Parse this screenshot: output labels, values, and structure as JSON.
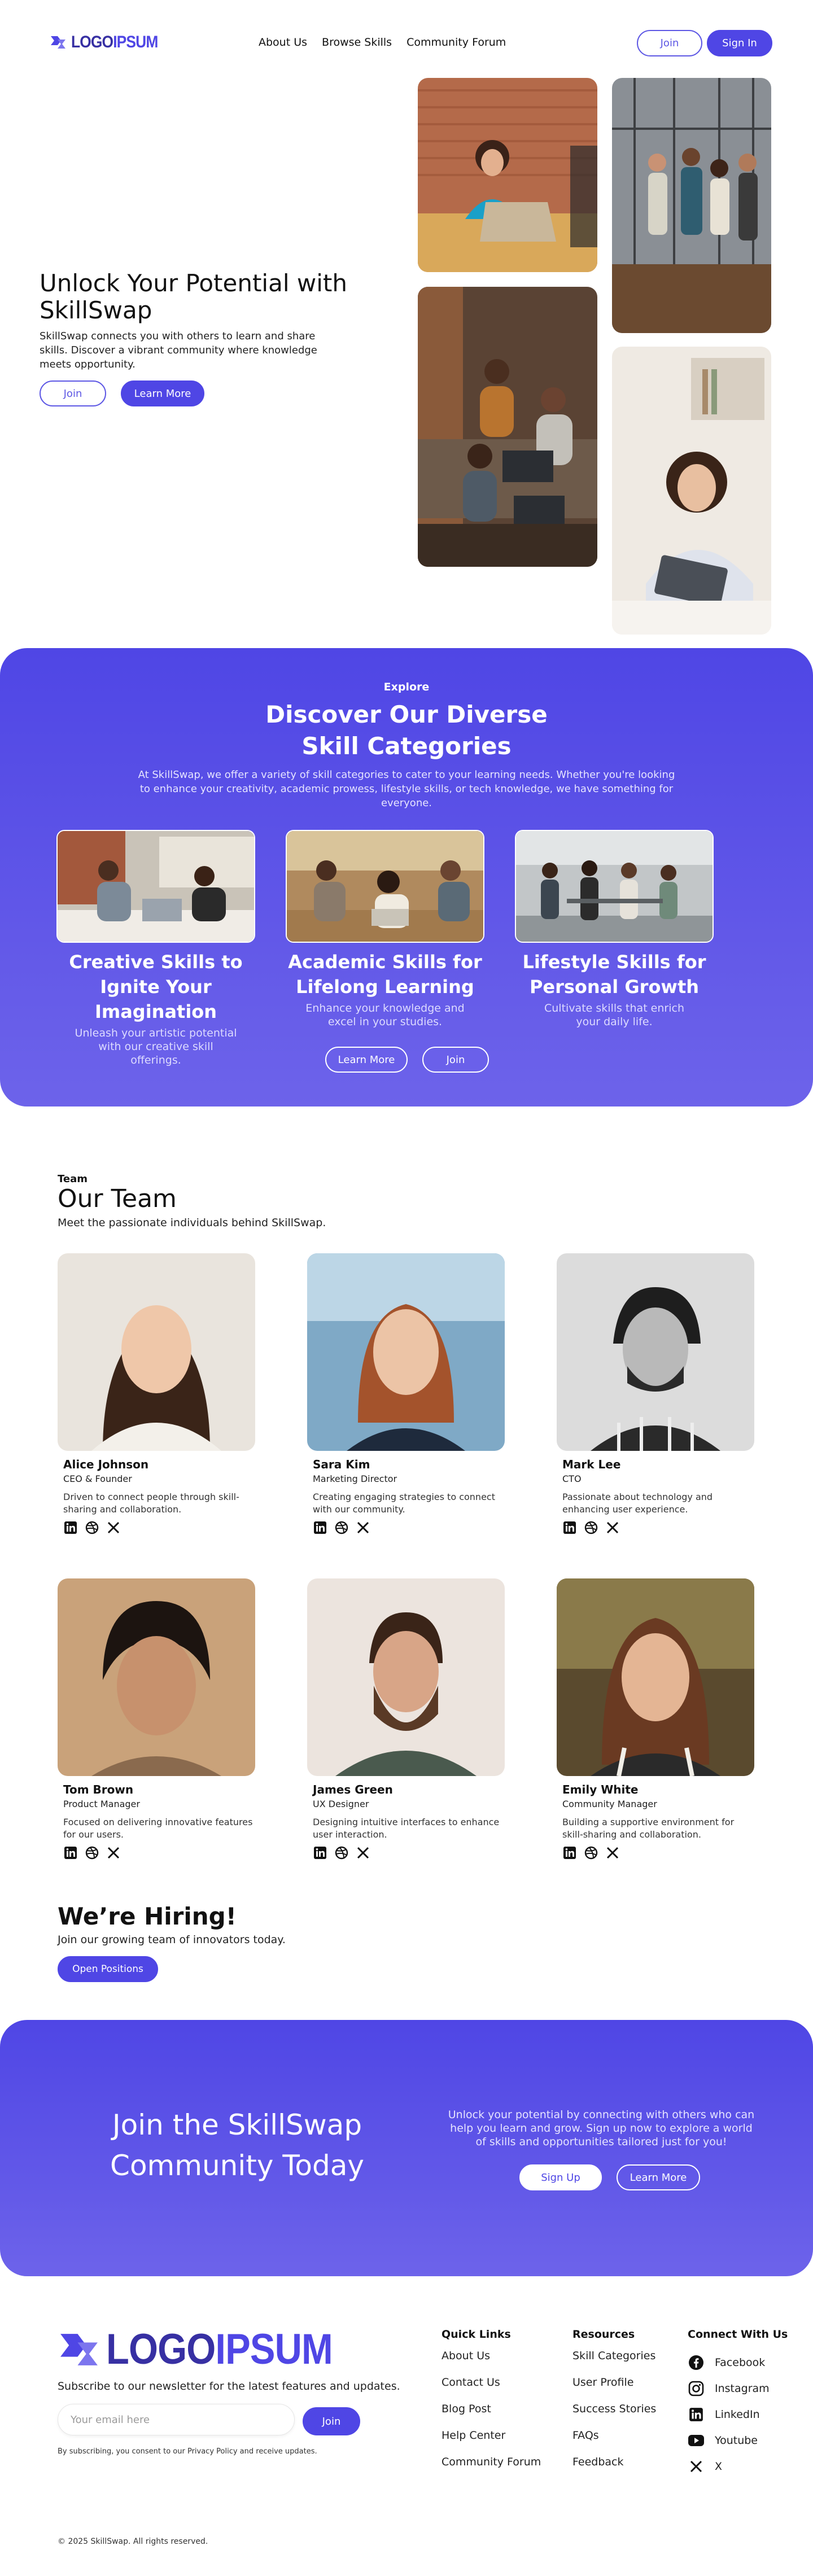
{
  "header": {
    "logo_text_a": "LOGO",
    "logo_text_b": "IPSUM",
    "nav": [
      "About Us",
      "Browse Skills",
      "Community Forum"
    ],
    "join_label": "Join",
    "signin_label": "Sign In"
  },
  "hero": {
    "title": "Unlock Your Potential with SkillSwap",
    "text": "SkillSwap connects you with others to learn and share skills. Discover a vibrant community where knowledge meets opportunity.",
    "join_label": "Join",
    "learn_label": "Learn More"
  },
  "explore": {
    "tag": "Explore",
    "title": "Discover Our Diverse Skill Categories",
    "text": "At SkillSwap, we offer a variety of skill categories to cater to your learning needs. Whether you're looking to enhance your creativity, academic prowess, lifestyle skills, or tech knowledge, we have something for everyone.",
    "categories": [
      {
        "title": "Creative Skills to Ignite Your Imagination",
        "desc": "Unleash your artistic potential with our creative skill offerings."
      },
      {
        "title": "Academic Skills for Lifelong Learning",
        "desc": "Enhance your knowledge and excel in your studies."
      },
      {
        "title": "Lifestyle Skills for Personal Growth",
        "desc": "Cultivate skills that enrich your daily life."
      }
    ],
    "learn_label": "Learn More",
    "join_label": "Join"
  },
  "team": {
    "tag": "Team",
    "title": "Our Team",
    "subtitle": "Meet the passionate individuals behind SkillSwap.",
    "members": [
      {
        "name": "Alice Johnson",
        "role": "CEO & Founder",
        "bio": "Driven to connect people through skill-sharing and collaboration."
      },
      {
        "name": "Sara Kim",
        "role": "Marketing Director",
        "bio": "Creating engaging strategies to connect with our community."
      },
      {
        "name": "Mark Lee",
        "role": "CTO",
        "bio": "Passionate about technology and enhancing user experience."
      },
      {
        "name": "Tom Brown",
        "role": "Product Manager",
        "bio": "Focused on delivering innovative features for our users."
      },
      {
        "name": "James Green",
        "role": "UX Designer",
        "bio": "Designing intuitive interfaces to enhance user interaction."
      },
      {
        "name": "Emily White",
        "role": "Community Manager",
        "bio": "Building a supportive environment for skill-sharing and collaboration."
      }
    ]
  },
  "hiring": {
    "title": "We’re Hiring!",
    "subtitle": "Join our growing team of innovators today.",
    "button": "Open Positions"
  },
  "cta": {
    "title": "Join the SkillSwap Community Today",
    "text": "Unlock your potential by connecting with others who can help you learn and grow. Sign up now to explore a world of skills and opportunities tailored just for you!",
    "signup_label": "Sign Up",
    "learn_label": "Learn More"
  },
  "footer": {
    "newsletter": "Subscribe to our newsletter for the latest features and updates.",
    "email_placeholder": "Your email here",
    "join_label": "Join",
    "consent": "By subscribing, you consent to our Privacy Policy and receive updates.",
    "quick_links": {
      "title": "Quick Links",
      "items": [
        "About Us",
        "Contact Us",
        "Blog Post",
        "Help Center",
        "Community Forum"
      ]
    },
    "resources": {
      "title": "Resources",
      "items": [
        "Skill Categories",
        "User Profile",
        "Success Stories",
        "FAQs",
        "Feedback"
      ]
    },
    "connect": {
      "title": "Connect With Us",
      "items": [
        "Facebook",
        "Instagram",
        "LinkedIn",
        "Youtube",
        "X"
      ]
    },
    "copyright": "© 2025 SkillSwap. All rights reserved."
  },
  "colors": {
    "brand": "#4f46e5",
    "brand_light": "#6d63ea"
  }
}
